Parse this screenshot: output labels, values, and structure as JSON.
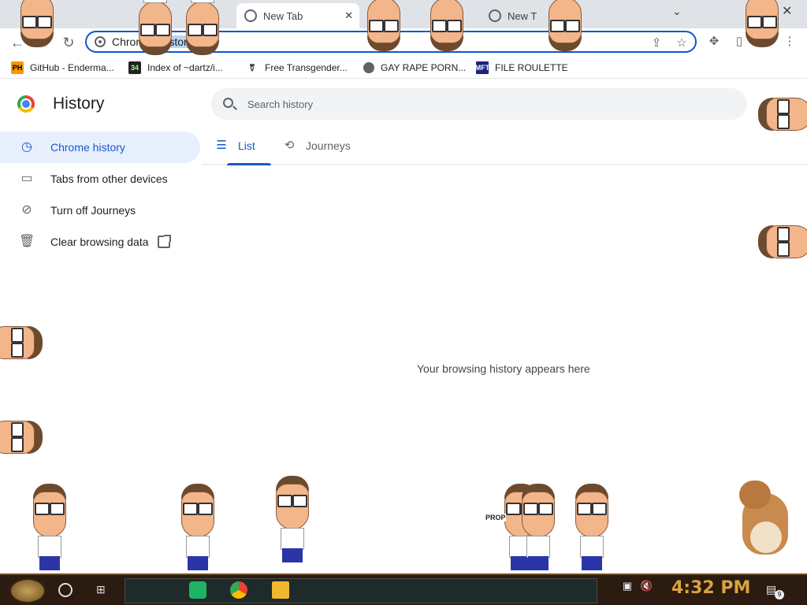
{
  "tabs": [
    {
      "label": "New Tab"
    },
    {
      "label": "New T"
    }
  ],
  "toolbar": {
    "url_prefix": "Chrome",
    "url_path": "//history"
  },
  "bookmarks": [
    {
      "label": "GitHub - Enderma...",
      "icon": "PH"
    },
    {
      "label": "Index of ~dartz/i...",
      "icon": "34"
    },
    {
      "label": "Free Transgender...",
      "icon": "transgender-icon"
    },
    {
      "label": "GAY RAPE PORN...",
      "icon": "globe-icon"
    },
    {
      "label": "FILE ROULETTE",
      "icon": "MFT"
    }
  ],
  "history": {
    "title": "History",
    "search_placeholder": "Search history",
    "nav": [
      {
        "label": "Chrome history",
        "icon": "clock-icon",
        "selected": true
      },
      {
        "label": "Tabs from other devices",
        "icon": "devices-icon",
        "selected": false
      },
      {
        "label": "Turn off Journeys",
        "icon": "journeys-off-icon",
        "selected": false
      },
      {
        "label": "Clear browsing data",
        "icon": "trash-icon",
        "selected": false
      }
    ],
    "tabs": [
      {
        "label": "List",
        "icon": "list-icon",
        "active": true
      },
      {
        "label": "Journeys",
        "icon": "journeys-icon",
        "active": false
      }
    ],
    "empty_message": "Your browsing history appears here"
  },
  "desktop": {
    "sign_text": "PROP"
  },
  "taskbar": {
    "clock": "4:32 PM",
    "notification_count": "9"
  },
  "colors": {
    "accent": "#1a56c8",
    "omnibox_border": "#0b57d0",
    "selected_nav_bg": "#e8f0fe",
    "clock": "#d9a441"
  }
}
